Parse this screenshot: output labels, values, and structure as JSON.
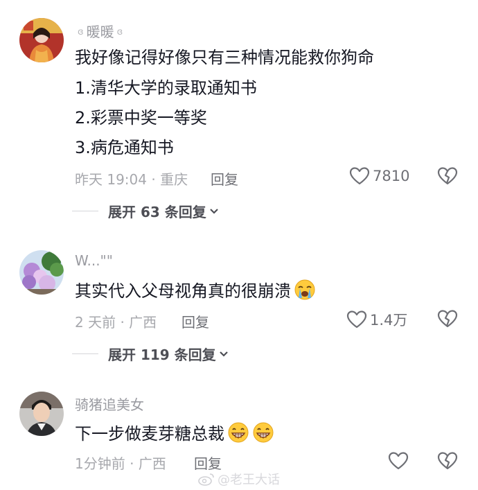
{
  "comments": [
    {
      "username": "暖暖",
      "username_deco_left": "ɞ",
      "username_deco_right": "ɞ",
      "lines": [
        "我好像记得好像只有三种情况能救你狗命",
        "1.清华大学的录取通知书",
        "2.彩票中奖一等奖",
        "3.病危通知书"
      ],
      "time_location": "昨天 19:04 · 重庆",
      "reply_label": "回复",
      "likes": "7810",
      "expand_label": "展开 63 条回复"
    },
    {
      "username": "W...\"\"",
      "lines": [
        "其实代入父母视角真的很崩溃"
      ],
      "emoji": "crying-face",
      "time_location": "2 天前 · 广西",
      "reply_label": "回复",
      "likes": "1.4万",
      "expand_label": "展开 119 条回复"
    },
    {
      "username": "骑猪追美女",
      "lines": [
        "下一步做麦芽糖总裁"
      ],
      "emoji": "grinning-face",
      "time_location": "1分钟前 · 广西",
      "reply_label": "回复",
      "likes": ""
    }
  ],
  "watermark": "@老王大话",
  "colors": {
    "text": "#161823",
    "meta": "#a7a8ad",
    "action": "#6e6f75"
  },
  "icons": [
    "heart-outline-icon",
    "broken-heart-icon",
    "chevron-down-icon",
    "weibo-logo-icon"
  ]
}
